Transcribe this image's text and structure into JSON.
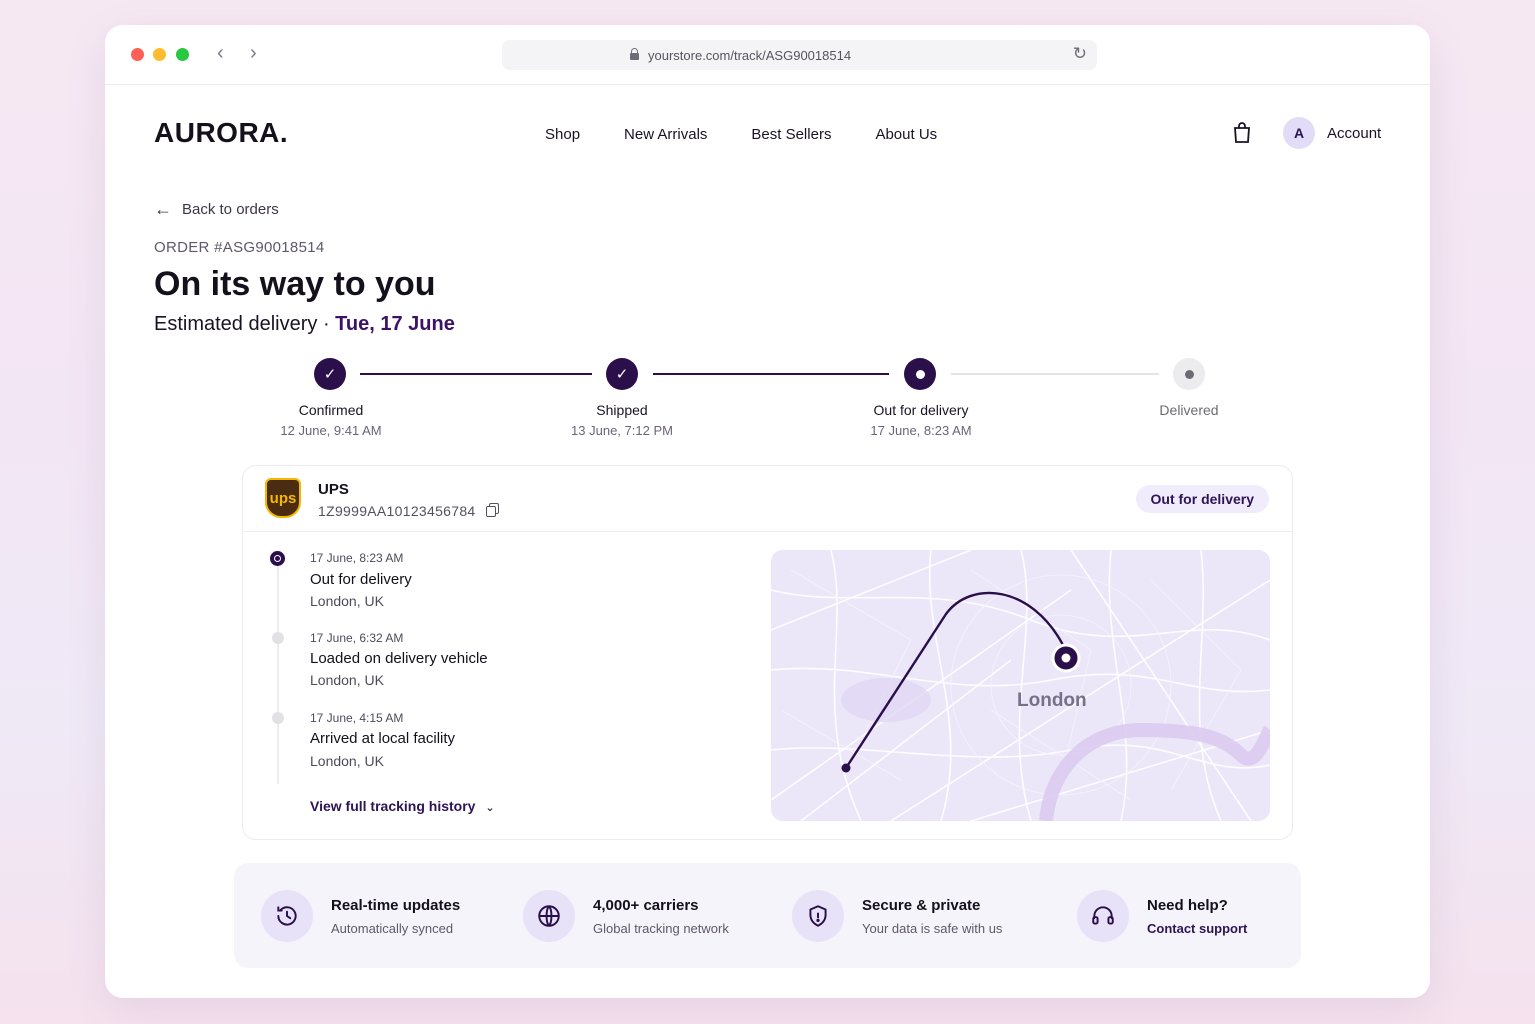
{
  "browser": {
    "url": "yourstore.com/track/ASG90018514"
  },
  "header": {
    "logo": "AURORA.",
    "nav": [
      "Shop",
      "New Arrivals",
      "Best Sellers",
      "About Us"
    ],
    "avatar_initial": "A",
    "account_label": "Account"
  },
  "page": {
    "back_label": "Back to orders",
    "order_number": "ORDER #ASG90018514",
    "title": "On its way to you",
    "eta_label": "Estimated delivery · ",
    "eta_date": "Tue, 17 June"
  },
  "steps": [
    {
      "label": "Confirmed",
      "time": "12 June, 9:41 AM",
      "state": "done"
    },
    {
      "label": "Shipped",
      "time": "13 June, 7:12 PM",
      "state": "done"
    },
    {
      "label": "Out for delivery",
      "time": "17 June, 8:23 AM",
      "state": "current"
    },
    {
      "label": "Delivered",
      "time": "",
      "state": "pending"
    }
  ],
  "shipment": {
    "carrier": "UPS",
    "carrier_logo_text": "ups",
    "tracking_number": "1Z9999AA10123456784",
    "status": "Out for delivery"
  },
  "events": [
    {
      "time": "17 June, 8:23 AM",
      "event": "Out for delivery",
      "location": "London, UK",
      "current": true
    },
    {
      "time": "17 June, 6:32 AM",
      "event": "Loaded on delivery vehicle",
      "location": "London, UK",
      "current": false
    },
    {
      "time": "17 June, 4:15 AM",
      "event": "Arrived at local facility",
      "location": "London, UK",
      "current": false
    }
  ],
  "history_link": "View full tracking history",
  "map": {
    "city": "London"
  },
  "features": [
    {
      "title": "Real-time updates",
      "subtitle": "Automatically synced",
      "icon": "clock-refresh-icon"
    },
    {
      "title": "4,000+ carriers",
      "subtitle": "Global tracking network",
      "icon": "globe-icon"
    },
    {
      "title": "Secure & private",
      "subtitle": "Your data is safe with us",
      "icon": "shield-icon"
    },
    {
      "title": "Need help?",
      "subtitle": "Contact support",
      "icon": "headset-icon"
    }
  ],
  "colors": {
    "brand": "#2a0f4a",
    "accent_text": "#3b1266",
    "pill_bg": "#f1ecfb"
  }
}
